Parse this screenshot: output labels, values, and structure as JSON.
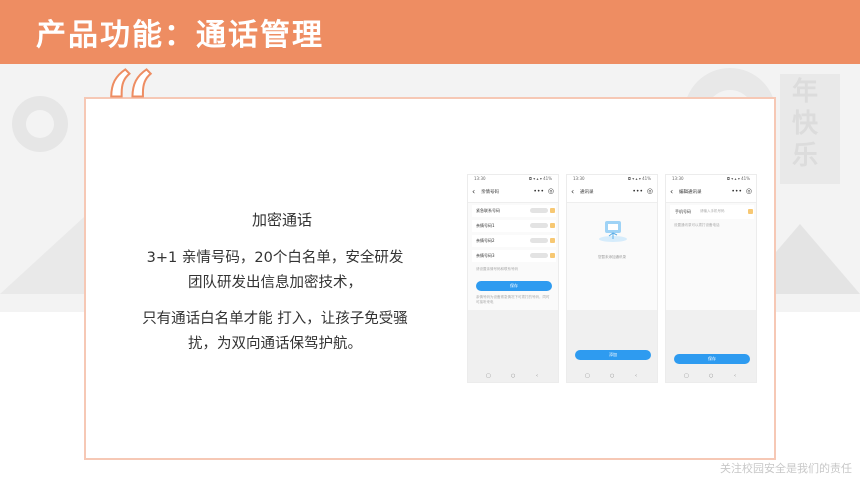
{
  "slide": {
    "title": "产品功能：通话管理",
    "quote_mark": "“",
    "feature_title": "加密通话",
    "paragraph1": "3+1 亲情号码，20个白名单，安全研发团队研发出信息加密技术，",
    "paragraph2": "只有通话白名单才能 打入，让孩子免受骚扰，为双向通话保驾护航。",
    "footer": "关注校园安全是我们的责任"
  },
  "decor": {
    "festival_text": "年快乐"
  },
  "phones": [
    {
      "time": "13:30",
      "signals": "◘ ▾ ▴ ▾ 41%",
      "title": "亲情号码",
      "rows": [
        "紧急联系号码",
        "亲情号码1",
        "亲情号码2",
        "亲情号码3"
      ],
      "hint": "请设置亲情号码和联系号码",
      "button": "保存",
      "note": "亲情号码为设备紧急情况下可拨打的号码，同时可接听来电"
    },
    {
      "time": "13:30",
      "signals": "◘ ▾ ▴ ▾ 41%",
      "title": "通讯录",
      "empty": "您暂未添加通讯录",
      "button": "添加"
    },
    {
      "time": "13:30",
      "signals": "◘ ▾ ▴ ▾ 41%",
      "title": "编辑通讯录",
      "field_label": "手机号码",
      "field_hint": "请输入手机号码",
      "hint": "设置通讯录可以拨打设备电话",
      "button": "保存"
    }
  ],
  "phone_icons": {
    "back": "‹",
    "more": "•••",
    "target": "◎",
    "nav_square": "▢",
    "nav_circle": "○",
    "nav_back": "‹"
  },
  "colors": {
    "header": "#ee8d62",
    "accent_blue": "#2e9bf0",
    "frame": "#f6c8b5"
  }
}
